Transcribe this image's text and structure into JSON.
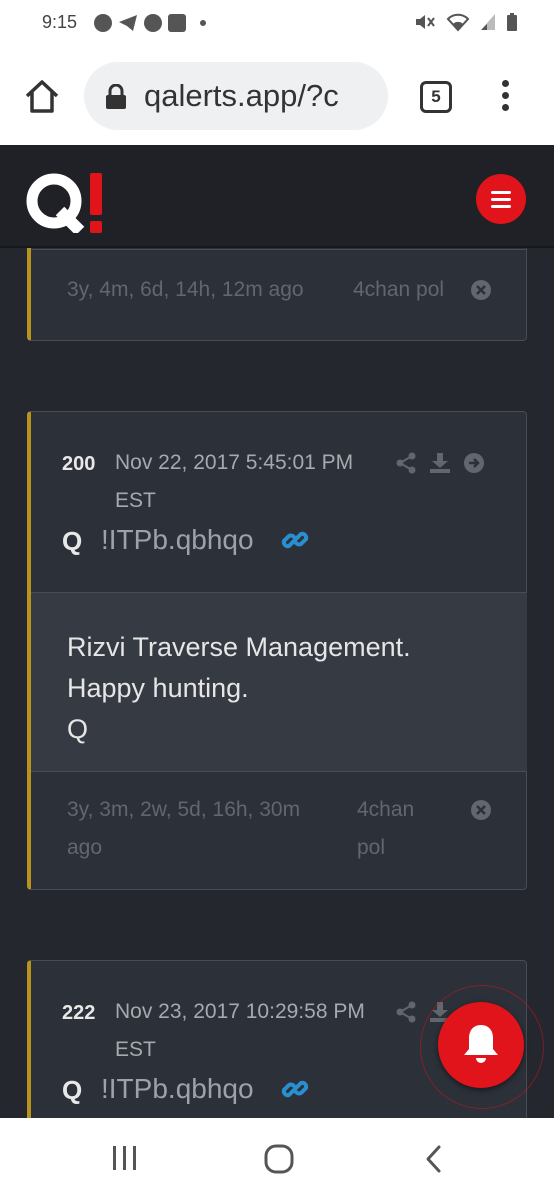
{
  "status_bar": {
    "time": "9:15",
    "notification_icons": [
      "messenger-icon",
      "telegram-icon",
      "messenger-icon",
      "facebook-icon",
      "dot-icon"
    ],
    "system_icons": [
      "mute-icon",
      "wifi-icon",
      "signal-icon",
      "battery-icon"
    ]
  },
  "browser": {
    "url": "qalerts.app/?c",
    "tab_count": "5"
  },
  "app": {
    "logo_text": "Q!",
    "accent_color": "#e2141b",
    "card_accent_color": "#b8941f"
  },
  "posts": [
    {
      "age": "3y, 4m, 6d, 14h, 12m ago",
      "source": "4chan pol"
    },
    {
      "number": "200",
      "date": "Nov 22, 2017 5:45:01 PM EST",
      "author": "Q",
      "tripcode": "!ITPb.qbhqo",
      "body": "Rizvi Traverse Management.\nHappy hunting.\nQ",
      "age": "3y, 3m, 2w, 5d, 16h, 30m ago",
      "source": "4chan pol"
    },
    {
      "number": "222",
      "date": "Nov 23, 2017 10:29:58 PM EST",
      "author": "Q",
      "tripcode": "!ITPb.qbhqo"
    }
  ]
}
